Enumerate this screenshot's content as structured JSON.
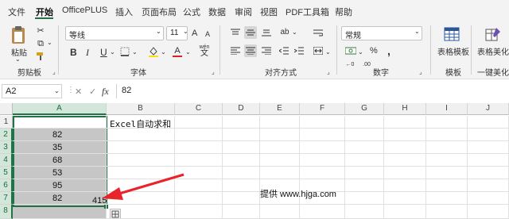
{
  "menu": {
    "items": [
      "文件",
      "开始",
      "OfficePLUS",
      "插入",
      "页面布局",
      "公式",
      "数据",
      "审阅",
      "视图",
      "PDF工具箱",
      "帮助"
    ]
  },
  "ribbon": {
    "clipboard": {
      "group": "剪贴板",
      "paste": "粘贴"
    },
    "font": {
      "group": "字体",
      "font_name": "等线",
      "font_size": "11",
      "bold": "B",
      "italic": "I",
      "underline": "U",
      "grow": "A",
      "shrink": "A",
      "font_color": "A",
      "wen": "wén"
    },
    "alignment": {
      "group": "对齐方式"
    },
    "number": {
      "group": "数字",
      "format": "常规",
      "percent": "%",
      "comma": ","
    },
    "table_format": {
      "label": "表格模板"
    },
    "template": {
      "group": "模板"
    },
    "table_beautify": {
      "label": "表格美化",
      "group": "一键美化"
    }
  },
  "formula_bar": {
    "name_box": "A2",
    "fx": "fx",
    "formula": "82",
    "cancel": "✕",
    "confirm": "✓"
  },
  "sheet": {
    "columns": [
      "A",
      "B",
      "C",
      "D",
      "E",
      "F",
      "G",
      "H",
      "I",
      "J"
    ],
    "rows": [
      "1",
      "2",
      "3",
      "4",
      "5",
      "6",
      "7",
      "8"
    ],
    "title": "Excel自动求和",
    "values": [
      "82",
      "35",
      "68",
      "53",
      "95",
      "82"
    ],
    "sum": "415",
    "watermark": "提供 www.hjga.com"
  },
  "colors": {
    "accent": "#217346",
    "selection": "#c6c6c6",
    "arrow": "#e8232a"
  }
}
